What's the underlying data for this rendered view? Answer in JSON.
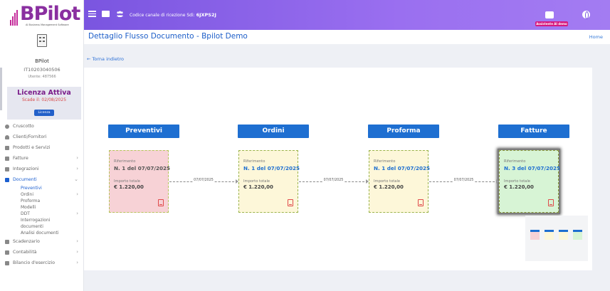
{
  "brand": {
    "logo_text": "BPilot",
    "logo_subtitle": "AI Business Management Software"
  },
  "company": {
    "name": "BPilot",
    "vat": "IT10203040506",
    "user": "Utente: 487566"
  },
  "license": {
    "title": "Licenza Attiva",
    "expiry": "Scade il: 02/08/2025",
    "button": "Licenza"
  },
  "topbar": {
    "code_label": "Codice canale di ricezione Sdi:",
    "code_value": "6JXPS2J",
    "assistant_label": "Assistente AI demo"
  },
  "sidebar": {
    "items": [
      {
        "label": "Cruscotto",
        "icon": "dashboard-icon",
        "chevron": ""
      },
      {
        "label": "Clienti/Fornitori",
        "icon": "user-icon",
        "chevron": ""
      },
      {
        "label": "Prodotti e Servizi",
        "icon": "box-icon",
        "chevron": ""
      },
      {
        "label": "Fatture",
        "icon": "document-icon",
        "chevron": "›"
      },
      {
        "label": "Integrazioni",
        "icon": "document-icon",
        "chevron": "›"
      },
      {
        "label": "Documenti",
        "icon": "document-icon",
        "chevron": "⌄"
      }
    ],
    "sub_items": [
      {
        "label": "Preventivi",
        "chevron": ""
      },
      {
        "label": "Ordini",
        "chevron": "›"
      },
      {
        "label": "Proforma",
        "chevron": ""
      },
      {
        "label": "Modelli",
        "chevron": ""
      },
      {
        "label": "DDT",
        "chevron": "›"
      },
      {
        "label": "Interrogazioni",
        "chevron": ""
      },
      {
        "label": "documenti",
        "chevron": ""
      },
      {
        "label": "Analisi documenti",
        "chevron": ""
      }
    ],
    "bottom_items": [
      {
        "label": "Scadenzario",
        "icon": "calendar-icon",
        "chevron": "›"
      },
      {
        "label": "Contabilità",
        "icon": "ledger-icon",
        "chevron": "›"
      },
      {
        "label": "Bilancio d'esercizio",
        "icon": "balance-icon",
        "chevron": "›"
      }
    ]
  },
  "header": {
    "title": "Dettaglio Flusso Documento - Bpilot Demo",
    "home": "Home"
  },
  "back": {
    "label": "Torna indietro"
  },
  "stages": [
    {
      "title": "Preventivi",
      "ref_label": "Riferimento",
      "ref": "N. 1 del 07/07/2025",
      "amount_label": "Importo totale",
      "amount": "€ 1.220,00",
      "color": "#f7d2d6"
    },
    {
      "title": "Ordini",
      "ref_label": "Riferimento",
      "ref": "N. 1 del 07/07/2025",
      "amount_label": "Importo totale",
      "amount": "€ 1.220,00",
      "color": "#fdf7d9"
    },
    {
      "title": "Proforma",
      "ref_label": "Riferimento",
      "ref": "N. 1 del 07/07/2025",
      "amount_label": "Importo totale",
      "amount": "€ 1.220,00",
      "color": "#fdf7d9"
    },
    {
      "title": "Fatture",
      "ref_label": "Riferimento",
      "ref": "N. 3 del 07/07/2025",
      "amount_label": "Importo totale",
      "amount": "€ 1.220,00",
      "color": "#d7f4d5"
    }
  ],
  "connectors": [
    "07/07/2025",
    "07/07/2025",
    "07/07/2025"
  ],
  "colors": {
    "accent": "#1e6fd1",
    "topbar": "#8a62e8",
    "brand": "#8a2fa0"
  }
}
